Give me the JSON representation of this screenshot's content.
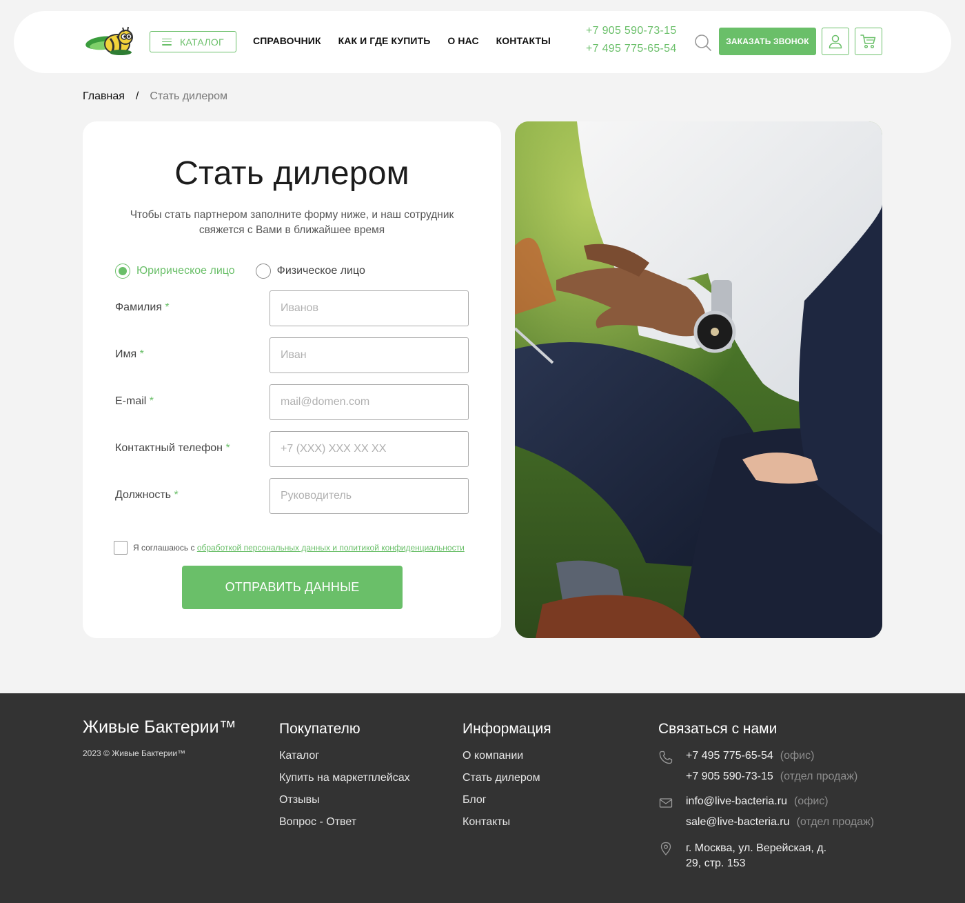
{
  "header": {
    "logo_alt": "logo",
    "catalog_label": "КАТАЛОГ",
    "nav": [
      "СПРАВОЧНИК",
      "КАК И ГДЕ КУПИТЬ",
      "О НАС",
      "КОНТАКТЫ"
    ],
    "phones": [
      "+7 905 590-73-15",
      "+7 495 775-65-54"
    ],
    "callback_label": "ЗАКАЗАТЬ ЗВОНОК"
  },
  "breadcrumb": {
    "home": "Главная",
    "separator": "/",
    "current": "Стать дилером"
  },
  "form": {
    "title": "Стать дилером",
    "subtitle_line1": "Чтобы стать партнером заполните форму ниже, и наш сотрудник",
    "subtitle_line2": "свяжется с Вами в ближайшее время",
    "radio_legal": "Юририческое лицо",
    "radio_individual": "Физическое лицо",
    "fields": [
      {
        "label": "Фамилия",
        "required": "*",
        "placeholder": "Иванов"
      },
      {
        "label": "Имя",
        "required": "*",
        "placeholder": "Иван"
      },
      {
        "label": "E-mail",
        "required": "*",
        "placeholder": "mail@domen.com"
      },
      {
        "label": "Контактный телефон",
        "required": "*",
        "placeholder": "+7 (XXX) XXX XX XX"
      },
      {
        "label": "Должность",
        "required": "*",
        "placeholder": "Руководитель"
      }
    ],
    "agree_prefix": "Я соглашаюсь с",
    "agree_link": "обработкой персональных данных и политикой конфиденциальности",
    "submit_label": "ОТПРАВИТЬ ДАННЫЕ"
  },
  "footer": {
    "brand": "Живые Бактерии™",
    "copyright": "2023 © Живые Бактерии™",
    "buyer_title": "Покупателю",
    "buyer_links": [
      "Каталог",
      "Купить на маркетплейсах",
      "Отзывы",
      "Вопрос - Ответ"
    ],
    "info_title": "Информация",
    "info_links": [
      "О компании",
      "Стать дилером",
      "Блог",
      "Контакты"
    ],
    "contact_title": "Связаться с нами",
    "phone1": "+7 495 775-65-54",
    "phone1_note": "(офис)",
    "phone2": "+7 905 590-73-15",
    "phone2_note": "(отдел продаж)",
    "email1": "info@live-bacteria.ru",
    "email1_note": "(офис)",
    "email2": "sale@live-bacteria.ru",
    "email2_note": "(отдел продаж)",
    "address_line1": "г. Москва, ул. Верейская, д.",
    "address_line2": "29, стр. 153"
  },
  "colors": {
    "accent": "#6abf69",
    "footer_bg": "#333333",
    "page_bg": "#f3f3f3"
  },
  "icons": [
    "logo-bee-icon",
    "menu-icon",
    "search-icon",
    "user-icon",
    "cart-icon",
    "phone-icon",
    "mail-icon",
    "location-icon"
  ]
}
